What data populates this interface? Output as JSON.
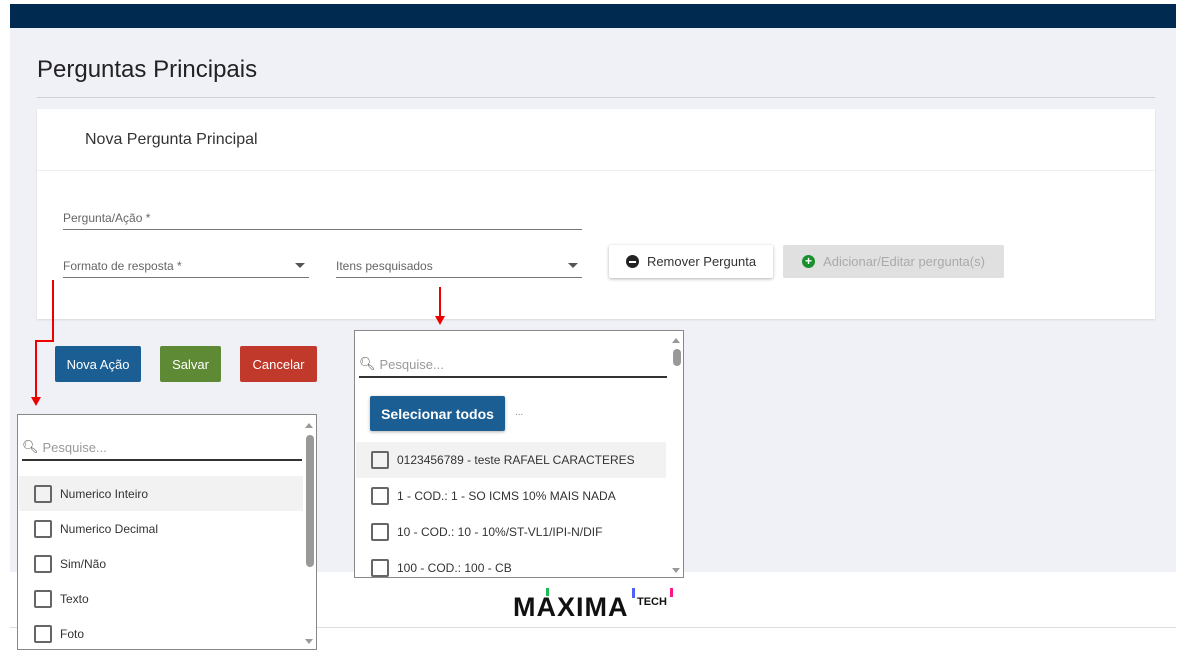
{
  "page": {
    "title": "Perguntas Principais"
  },
  "card": {
    "title": "Nova Pergunta Principal",
    "pergunta_label": "Pergunta/Ação *",
    "formato_label": "Formato de resposta *",
    "itens_label": "Itens pesquisados",
    "remove_button": "Remover Pergunta",
    "add_button": "Adicionar/Editar pergunta(s)"
  },
  "actions": {
    "nova_acao": "Nova Ação",
    "salvar": "Salvar",
    "cancelar": "Cancelar"
  },
  "formato_dropdown": {
    "search_placeholder": "Pesquise...",
    "options": [
      "Numerico Inteiro",
      "Numerico Decimal",
      "Sim/Não",
      "Texto",
      "Foto"
    ]
  },
  "itens_dropdown": {
    "search_placeholder": "Pesquise...",
    "select_all": "Selecionar todos",
    "ellipsis": "...",
    "options": [
      "0123456789 - teste RAFAEL CARACTERES",
      "1 - COD.: 1 - SO ICMS 10% MAIS NADA",
      "10 - COD.: 10 - 10%/ST-VL1/IPI-N/DIF",
      "100 - COD.: 100 - CB"
    ]
  },
  "footer": {
    "logo": "maxima TECH"
  },
  "colors": {
    "topbar": "#002a4f",
    "primary": "#1b5e93",
    "success": "#5f8a35",
    "danger": "#c0392b",
    "annotation": "#e00000"
  }
}
